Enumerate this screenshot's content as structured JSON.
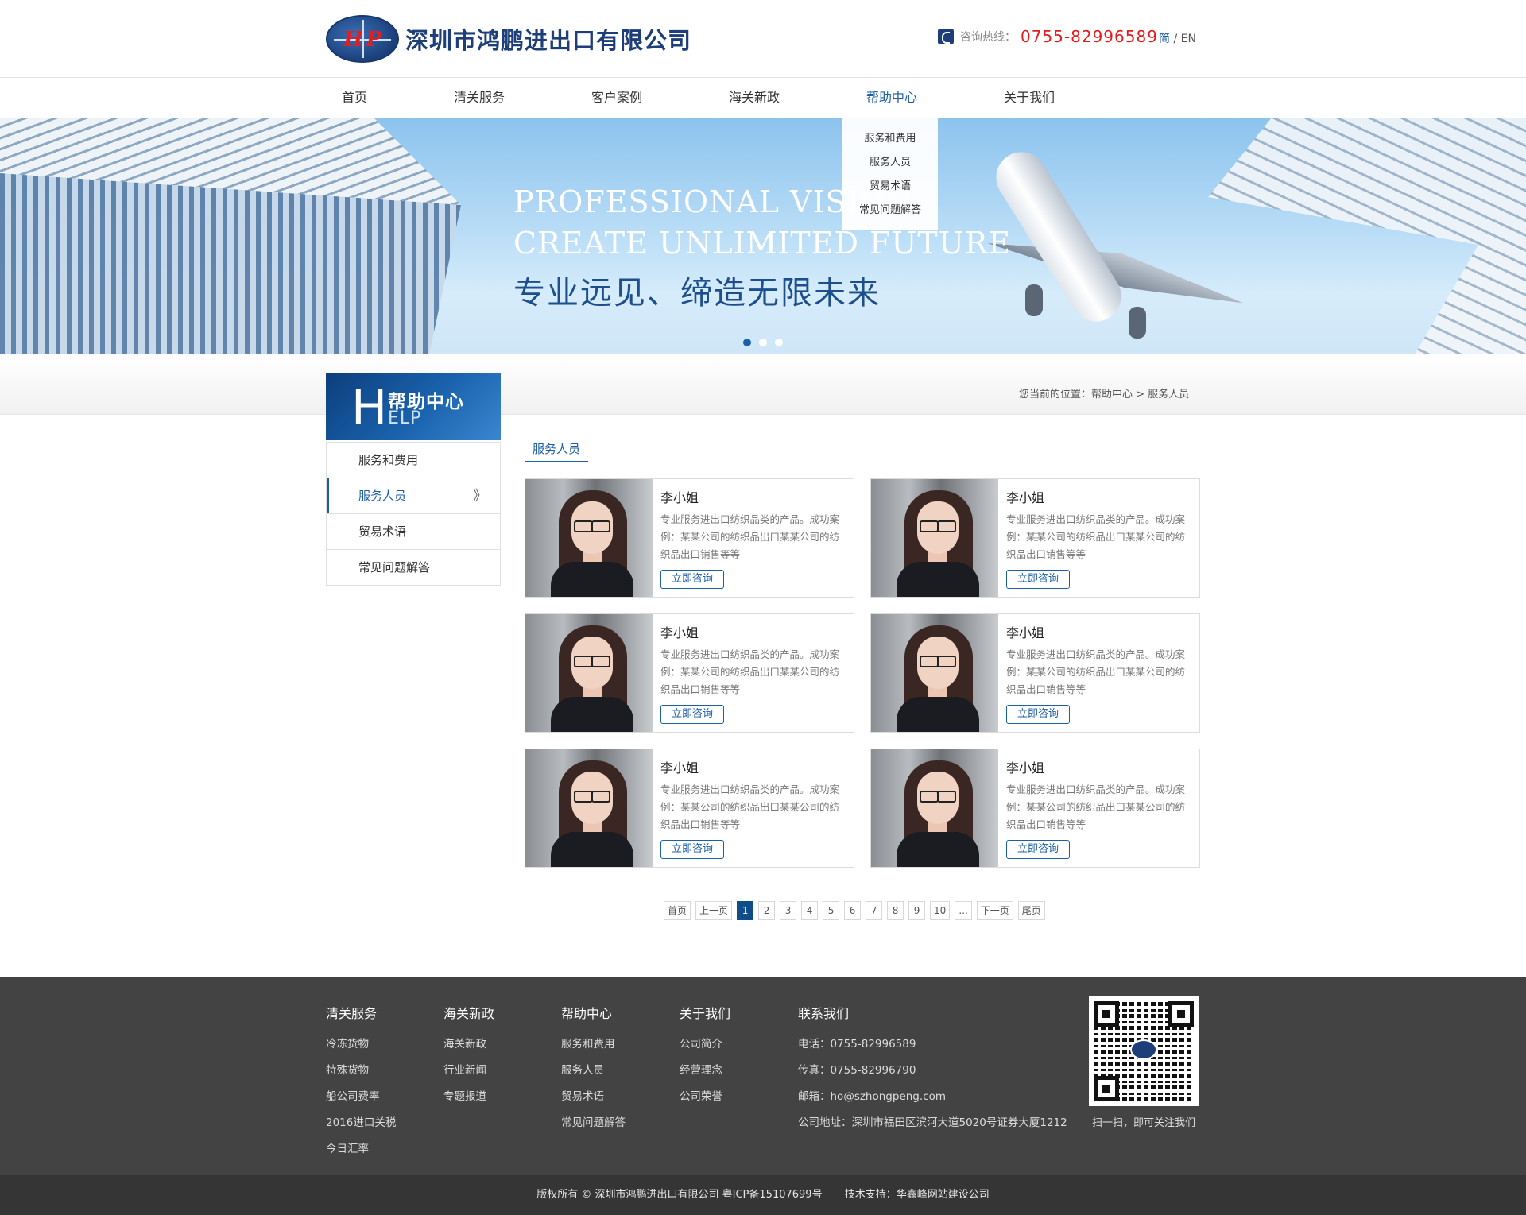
{
  "header": {
    "logo_mark": "HP",
    "company_name": "深圳市鸿鹏进出口有限公司",
    "hotline_label": "咨询热线：",
    "hotline_number": "0755-82996589",
    "lang_zh": "简",
    "lang_sep": "/",
    "lang_en": "EN"
  },
  "nav": {
    "items": [
      {
        "label": "首页"
      },
      {
        "label": "清关服务"
      },
      {
        "label": "客户案例"
      },
      {
        "label": "海关新政"
      },
      {
        "label": "帮助中心"
      },
      {
        "label": "关于我们"
      }
    ],
    "active_index": 4,
    "dropdown": [
      "服务和费用",
      "服务人员",
      "贸易术语",
      "常见问题解答"
    ]
  },
  "banner": {
    "en_line1": "PROFESSIONAL VISION",
    "en_line2": "CREATE UNLIMITED FUTURE",
    "cn": "专业远见、缔造无限未来",
    "slide_count": 3,
    "active_slide": 1
  },
  "sidebar": {
    "head_letter": "H",
    "head_cn": "帮助中心",
    "head_en": "ELP",
    "items": [
      {
        "label": "服务和费用"
      },
      {
        "label": "服务人员"
      },
      {
        "label": "贸易术语"
      },
      {
        "label": "常见问题解答"
      }
    ],
    "active_index": 1,
    "arrow_glyph": "》"
  },
  "breadcrumb": {
    "prefix": "您当前的位置：",
    "level1": "帮助中心",
    "sep": " > ",
    "level2": "服务人员"
  },
  "section": {
    "title": "服务人员"
  },
  "cards": [
    {
      "name": "李小姐",
      "desc": "专业服务进出口纺织品类的产品。成功案例：某某公司的纺织品出口某某公司的纺织品出口销售等等",
      "button": "立即咨询"
    },
    {
      "name": "李小姐",
      "desc": "专业服务进出口纺织品类的产品。成功案例：某某公司的纺织品出口某某公司的纺织品出口销售等等",
      "button": "立即咨询"
    },
    {
      "name": "李小姐",
      "desc": "专业服务进出口纺织品类的产品。成功案例：某某公司的纺织品出口某某公司的纺织品出口销售等等",
      "button": "立即咨询"
    },
    {
      "name": "李小姐",
      "desc": "专业服务进出口纺织品类的产品。成功案例：某某公司的纺织品出口某某公司的纺织品出口销售等等",
      "button": "立即咨询"
    },
    {
      "name": "李小姐",
      "desc": "专业服务进出口纺织品类的产品。成功案例：某某公司的纺织品出口某某公司的纺织品出口销售等等",
      "button": "立即咨询"
    },
    {
      "name": "李小姐",
      "desc": "专业服务进出口纺织品类的产品。成功案例：某某公司的纺织品出口某某公司的纺织品出口销售等等",
      "button": "立即咨询"
    }
  ],
  "pagination": {
    "items": [
      "首页",
      "上一页",
      "1",
      "2",
      "3",
      "4",
      "5",
      "6",
      "7",
      "8",
      "9",
      "10",
      "...",
      "下一页",
      "尾页"
    ],
    "current": "1"
  },
  "footer": {
    "columns": [
      {
        "title": "清关服务",
        "items": [
          "冷冻货物",
          "特殊货物",
          "船公司费率",
          "2016进口关税",
          "今日汇率"
        ]
      },
      {
        "title": "海关新政",
        "items": [
          "海关新政",
          "行业新闻",
          "专题报道"
        ]
      },
      {
        "title": "帮助中心",
        "items": [
          "服务和费用",
          "服务人员",
          "贸易术语",
          "常见问题解答"
        ]
      },
      {
        "title": "关于我们",
        "items": [
          "公司简介",
          "经营理念",
          "公司荣誉"
        ]
      },
      {
        "title": "联系我们",
        "items": [
          "电话：0755-82996589",
          "传真：0755-82996790",
          "邮箱：ho@szhongpeng.com",
          "公司地址：深圳市福田区滨河大道5020号证券大厦1212"
        ]
      }
    ],
    "qr_caption": "扫一扫，即可关注我们",
    "copyright": "版权所有 © 深圳市鸿鹏进出口有限公司 粤ICP备15107699号",
    "support": "技术支持：华鑫峰网站建设公司"
  },
  "colors": {
    "brand_blue": "#1d5fa6",
    "hotline_red": "#e01d1d",
    "footer_bg": "#434343"
  }
}
